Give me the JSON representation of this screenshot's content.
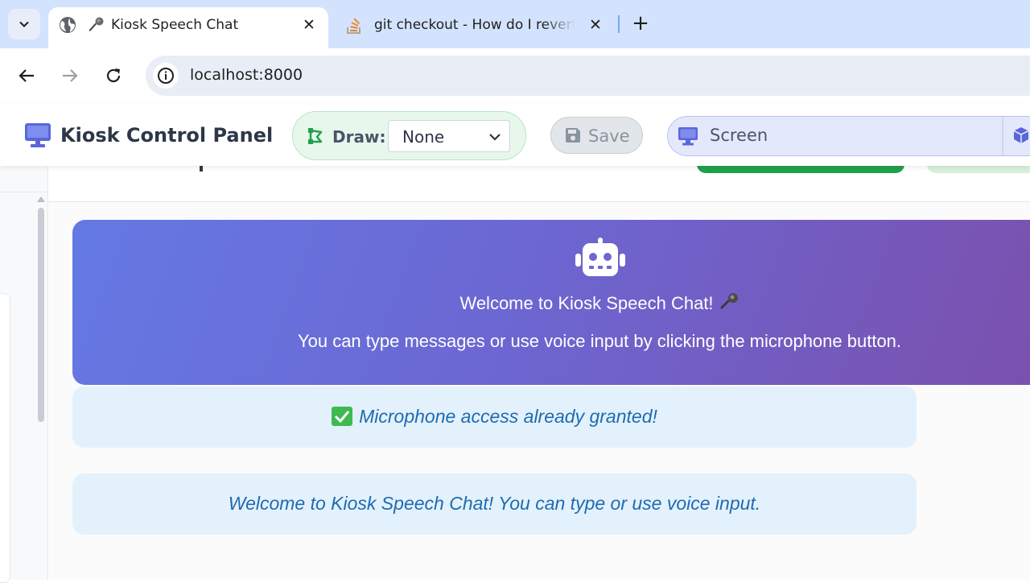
{
  "browser": {
    "tabs": [
      {
        "title": "Kiosk Speech Chat",
        "active": true
      },
      {
        "title": "git checkout - How do I revert a",
        "active": false
      }
    ],
    "url": "localhost:8000"
  },
  "header": {
    "title": "Kiosk Control Panel",
    "draw_label": "Draw:",
    "draw_value": "None",
    "save_label": "Save",
    "screen_label": "Screen"
  },
  "chat": {
    "welcome_title": "Welcome to Kiosk Speech Chat!",
    "welcome_subtitle": "You can type messages or use voice input by clicking the microphone button.",
    "messages": [
      {
        "text": "Microphone access already granted!"
      },
      {
        "text": "Welcome to Kiosk Speech Chat! You can type or use voice input."
      }
    ]
  },
  "colors": {
    "accent": "#667eea",
    "hero_end": "#764ba2",
    "draw_bg": "#e8f7ec",
    "message_bg": "#e3f1fc",
    "message_text": "#1e6bb0",
    "success_green": "#22a04b"
  },
  "icons": [
    "tab-search-icon",
    "globe-icon",
    "microphone-icon",
    "stack-overflow-icon",
    "close-icon",
    "plus-icon",
    "back-arrow-icon",
    "forward-arrow-icon",
    "reload-icon",
    "info-icon",
    "monitor-icon",
    "draw-shape-icon",
    "chevron-down-icon",
    "floppy-disk-icon",
    "cube-icon",
    "robot-icon",
    "check-mark-icon"
  ]
}
